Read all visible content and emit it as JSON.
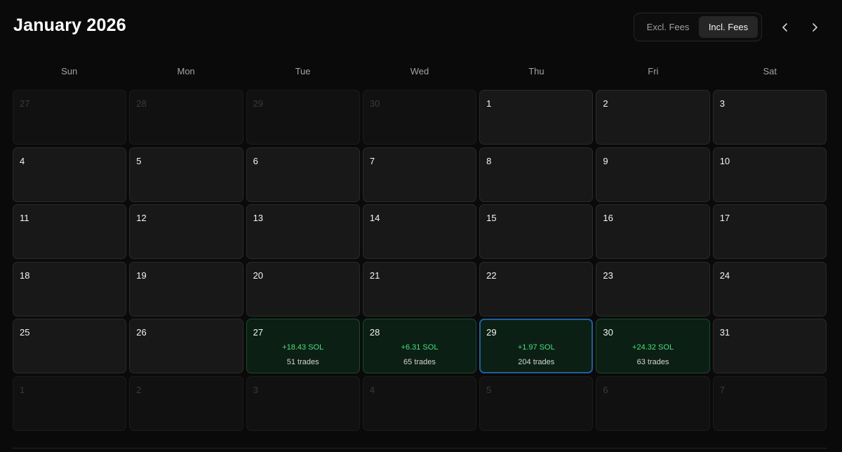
{
  "header": {
    "title": "January 2026",
    "fee_toggle": {
      "excl_label": "Excl. Fees",
      "incl_label": "Incl. Fees",
      "selected": "Incl. Fees"
    },
    "nav": {
      "prev_icon": "chevron-left-icon",
      "next_icon": "chevron-right-icon"
    }
  },
  "weekdays": [
    "Sun",
    "Mon",
    "Tue",
    "Wed",
    "Thu",
    "Fri",
    "Sat"
  ],
  "colors": {
    "background": "#0a0a0a",
    "cell": "#181818",
    "profit_cell": "#0b1f14",
    "profit_text": "#4ade80",
    "today_border": "#1f5f9a"
  },
  "days": [
    {
      "day": "27",
      "outside": true
    },
    {
      "day": "28",
      "outside": true
    },
    {
      "day": "29",
      "outside": true
    },
    {
      "day": "30",
      "outside": true
    },
    {
      "day": "1"
    },
    {
      "day": "2"
    },
    {
      "day": "3"
    },
    {
      "day": "4"
    },
    {
      "day": "5"
    },
    {
      "day": "6"
    },
    {
      "day": "7"
    },
    {
      "day": "8"
    },
    {
      "day": "9"
    },
    {
      "day": "10"
    },
    {
      "day": "11"
    },
    {
      "day": "12"
    },
    {
      "day": "13"
    },
    {
      "day": "14"
    },
    {
      "day": "15"
    },
    {
      "day": "16"
    },
    {
      "day": "17"
    },
    {
      "day": "18"
    },
    {
      "day": "19"
    },
    {
      "day": "20"
    },
    {
      "day": "21"
    },
    {
      "day": "22"
    },
    {
      "day": "23"
    },
    {
      "day": "24"
    },
    {
      "day": "25"
    },
    {
      "day": "26"
    },
    {
      "day": "27",
      "pnl": "+18.43 SOL",
      "trades": "51 trades"
    },
    {
      "day": "28",
      "pnl": "+6.31 SOL",
      "trades": "65 trades"
    },
    {
      "day": "29",
      "pnl": "+1.97 SOL",
      "trades": "204 trades",
      "today": true
    },
    {
      "day": "30",
      "pnl": "+24.32 SOL",
      "trades": "63 trades"
    },
    {
      "day": "31"
    },
    {
      "day": "1",
      "outside": true
    },
    {
      "day": "2",
      "outside": true
    },
    {
      "day": "3",
      "outside": true
    },
    {
      "day": "4",
      "outside": true
    },
    {
      "day": "5",
      "outside": true
    },
    {
      "day": "6",
      "outside": true
    },
    {
      "day": "7",
      "outside": true
    }
  ]
}
